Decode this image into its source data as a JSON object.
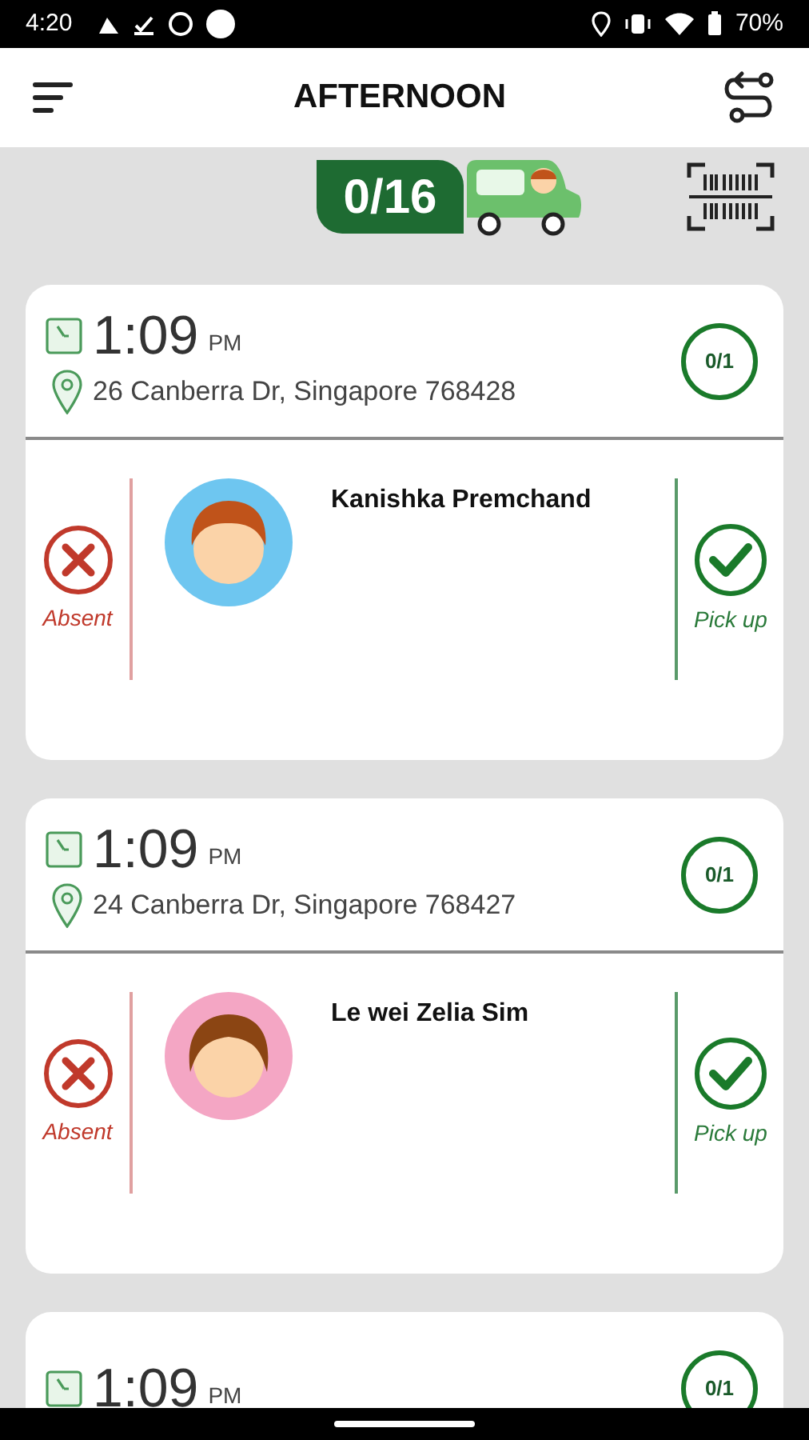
{
  "status_bar": {
    "time": "4:20",
    "battery": "70%"
  },
  "header": {
    "title": "AFTERNOON"
  },
  "summary": {
    "count": "0/16"
  },
  "stops": [
    {
      "time": "1:09",
      "period": "PM",
      "address": "26 Canberra Dr, Singapore 768428",
      "count": "0/1",
      "student": {
        "name": "Kanishka Premchand",
        "kind": "boy",
        "color": "#6ec6f0",
        "absent_label": "Absent",
        "pickup_label": "Pick up"
      }
    },
    {
      "time": "1:09",
      "period": "PM",
      "address": "24 Canberra Dr, Singapore 768427",
      "count": "0/1",
      "student": {
        "name": "Le wei Zelia Sim",
        "kind": "girl",
        "color": "#f4a6c4",
        "absent_label": "Absent",
        "pickup_label": "Pick up"
      }
    },
    {
      "time": "1:09",
      "period": "PM",
      "count": "0/1"
    }
  ]
}
